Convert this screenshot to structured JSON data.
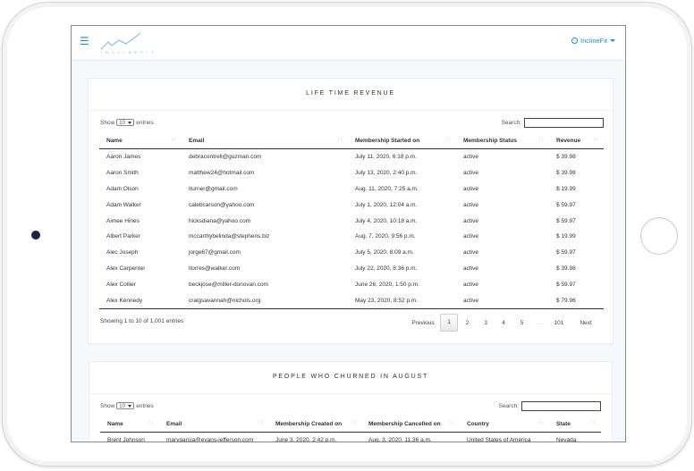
{
  "header": {
    "logo_text": "I N C L I N E F I T",
    "user_label": "InclineFit"
  },
  "revenue": {
    "title": "LIFE TIME REVENUE",
    "show_prefix": "Show",
    "show_value": "10",
    "show_suffix": "entries",
    "search_label": "Search:",
    "columns": [
      "Name",
      "Email",
      "Membership Started on",
      "Membership Status",
      "Revenue"
    ],
    "rows": [
      [
        "Aaron James",
        "debracontrell@guzman.com",
        "July 11, 2020, 6:18 p.m.",
        "active",
        "$ 39.98"
      ],
      [
        "Aaron Smith",
        "matthew24@hotmail.com",
        "July 13, 2020, 2:40 p.m.",
        "active",
        "$ 39.98"
      ],
      [
        "Adam Olson",
        "iturner@gmail.com",
        "Aug. 11, 2020, 7:25 a.m.",
        "active",
        "$ 19.99"
      ],
      [
        "Adam Walker",
        "calebcarson@yahoo.com",
        "July 1, 2020, 12:04 a.m.",
        "active",
        "$ 59.97"
      ],
      [
        "Aimee Hines",
        "hicksdiana@yahoo.com",
        "July 4, 2020, 10:18 a.m.",
        "active",
        "$ 59.97"
      ],
      [
        "Albert Parker",
        "mccarthybelinda@stephens.biz",
        "Aug. 7, 2020, 9:56 p.m.",
        "active",
        "$ 19.99"
      ],
      [
        "Alec Joseph",
        "jorge67@gmail.com",
        "July 5, 2020, 8:09 a.m.",
        "active",
        "$ 59.97"
      ],
      [
        "Alex Carpenter",
        "ltorres@walker.com",
        "July 22, 2020, 8:36 p.m.",
        "active",
        "$ 39.98"
      ],
      [
        "Alex Collier",
        "beckjose@miller-donovan.com",
        "June 26, 2020, 1:50 p.m.",
        "active",
        "$ 59.97"
      ],
      [
        "Alex Kennedy",
        "craigsavannah@nichols.org",
        "May 23, 2020, 8:52 p.m.",
        "active",
        "$ 79.96"
      ]
    ],
    "info": "Showing 1 to 10 of 1,001 entries",
    "pager": {
      "previous": "Previous",
      "pages": [
        "1",
        "2",
        "3",
        "4",
        "5",
        "…",
        "101"
      ],
      "next": "Next"
    }
  },
  "churn": {
    "title": "PEOPLE WHO CHURNED IN AUGUST",
    "show_prefix": "Show",
    "show_value": "10",
    "show_suffix": "entries",
    "search_label": "Search:",
    "columns": [
      "Name",
      "Email",
      "Membership Created on",
      "Membership Cancelled on",
      "Country",
      "State"
    ],
    "rows": [
      [
        "Brent Johnson",
        "marygarcia@evans-jefferson.com",
        "June 3, 2020, 2:42 p.m.",
        "Aug. 3, 2020, 11:36 a.m.",
        "United States of America",
        "Nevada"
      ]
    ]
  },
  "colors": {
    "accent": "#1d8fd1",
    "logo": "#6cc0e8",
    "background": "#f6f8fc"
  }
}
